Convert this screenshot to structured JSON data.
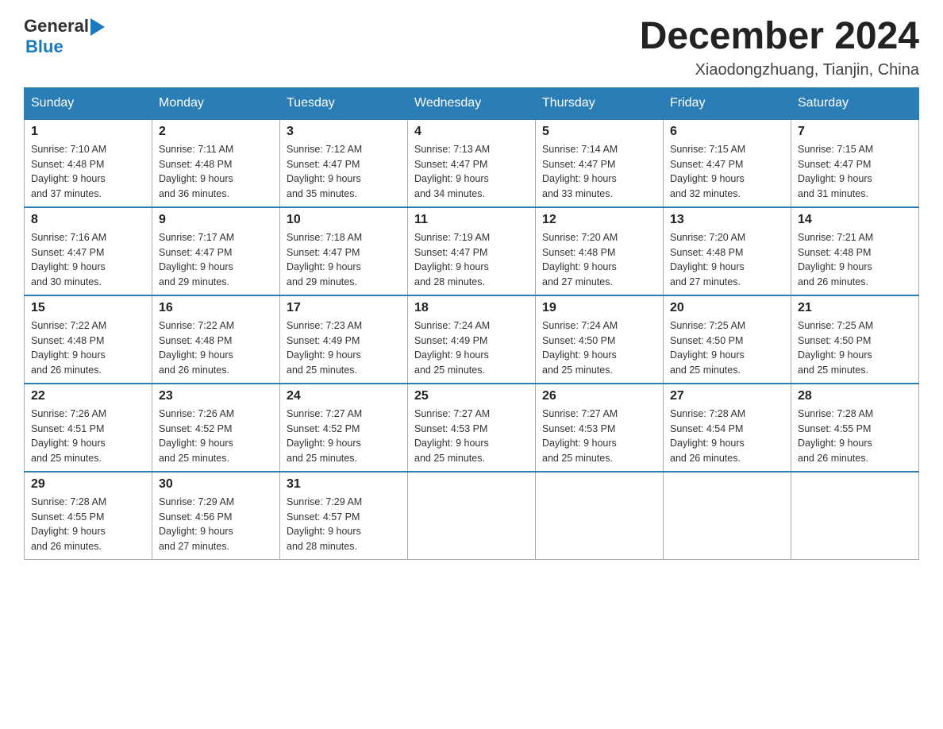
{
  "header": {
    "logo": {
      "general": "General",
      "blue": "Blue",
      "alt": "GeneralBlue Logo"
    },
    "title": "December 2024",
    "location": "Xiaodongzhuang, Tianjin, China"
  },
  "calendar": {
    "days_of_week": [
      "Sunday",
      "Monday",
      "Tuesday",
      "Wednesday",
      "Thursday",
      "Friday",
      "Saturday"
    ],
    "weeks": [
      [
        {
          "day": "1",
          "sunrise": "7:10 AM",
          "sunset": "4:48 PM",
          "daylight": "9 hours and 37 minutes."
        },
        {
          "day": "2",
          "sunrise": "7:11 AM",
          "sunset": "4:48 PM",
          "daylight": "9 hours and 36 minutes."
        },
        {
          "day": "3",
          "sunrise": "7:12 AM",
          "sunset": "4:47 PM",
          "daylight": "9 hours and 35 minutes."
        },
        {
          "day": "4",
          "sunrise": "7:13 AM",
          "sunset": "4:47 PM",
          "daylight": "9 hours and 34 minutes."
        },
        {
          "day": "5",
          "sunrise": "7:14 AM",
          "sunset": "4:47 PM",
          "daylight": "9 hours and 33 minutes."
        },
        {
          "day": "6",
          "sunrise": "7:15 AM",
          "sunset": "4:47 PM",
          "daylight": "9 hours and 32 minutes."
        },
        {
          "day": "7",
          "sunrise": "7:15 AM",
          "sunset": "4:47 PM",
          "daylight": "9 hours and 31 minutes."
        }
      ],
      [
        {
          "day": "8",
          "sunrise": "7:16 AM",
          "sunset": "4:47 PM",
          "daylight": "9 hours and 30 minutes."
        },
        {
          "day": "9",
          "sunrise": "7:17 AM",
          "sunset": "4:47 PM",
          "daylight": "9 hours and 29 minutes."
        },
        {
          "day": "10",
          "sunrise": "7:18 AM",
          "sunset": "4:47 PM",
          "daylight": "9 hours and 29 minutes."
        },
        {
          "day": "11",
          "sunrise": "7:19 AM",
          "sunset": "4:47 PM",
          "daylight": "9 hours and 28 minutes."
        },
        {
          "day": "12",
          "sunrise": "7:20 AM",
          "sunset": "4:48 PM",
          "daylight": "9 hours and 27 minutes."
        },
        {
          "day": "13",
          "sunrise": "7:20 AM",
          "sunset": "4:48 PM",
          "daylight": "9 hours and 27 minutes."
        },
        {
          "day": "14",
          "sunrise": "7:21 AM",
          "sunset": "4:48 PM",
          "daylight": "9 hours and 26 minutes."
        }
      ],
      [
        {
          "day": "15",
          "sunrise": "7:22 AM",
          "sunset": "4:48 PM",
          "daylight": "9 hours and 26 minutes."
        },
        {
          "day": "16",
          "sunrise": "7:22 AM",
          "sunset": "4:48 PM",
          "daylight": "9 hours and 26 minutes."
        },
        {
          "day": "17",
          "sunrise": "7:23 AM",
          "sunset": "4:49 PM",
          "daylight": "9 hours and 25 minutes."
        },
        {
          "day": "18",
          "sunrise": "7:24 AM",
          "sunset": "4:49 PM",
          "daylight": "9 hours and 25 minutes."
        },
        {
          "day": "19",
          "sunrise": "7:24 AM",
          "sunset": "4:50 PM",
          "daylight": "9 hours and 25 minutes."
        },
        {
          "day": "20",
          "sunrise": "7:25 AM",
          "sunset": "4:50 PM",
          "daylight": "9 hours and 25 minutes."
        },
        {
          "day": "21",
          "sunrise": "7:25 AM",
          "sunset": "4:50 PM",
          "daylight": "9 hours and 25 minutes."
        }
      ],
      [
        {
          "day": "22",
          "sunrise": "7:26 AM",
          "sunset": "4:51 PM",
          "daylight": "9 hours and 25 minutes."
        },
        {
          "day": "23",
          "sunrise": "7:26 AM",
          "sunset": "4:52 PM",
          "daylight": "9 hours and 25 minutes."
        },
        {
          "day": "24",
          "sunrise": "7:27 AM",
          "sunset": "4:52 PM",
          "daylight": "9 hours and 25 minutes."
        },
        {
          "day": "25",
          "sunrise": "7:27 AM",
          "sunset": "4:53 PM",
          "daylight": "9 hours and 25 minutes."
        },
        {
          "day": "26",
          "sunrise": "7:27 AM",
          "sunset": "4:53 PM",
          "daylight": "9 hours and 25 minutes."
        },
        {
          "day": "27",
          "sunrise": "7:28 AM",
          "sunset": "4:54 PM",
          "daylight": "9 hours and 26 minutes."
        },
        {
          "day": "28",
          "sunrise": "7:28 AM",
          "sunset": "4:55 PM",
          "daylight": "9 hours and 26 minutes."
        }
      ],
      [
        {
          "day": "29",
          "sunrise": "7:28 AM",
          "sunset": "4:55 PM",
          "daylight": "9 hours and 26 minutes."
        },
        {
          "day": "30",
          "sunrise": "7:29 AM",
          "sunset": "4:56 PM",
          "daylight": "9 hours and 27 minutes."
        },
        {
          "day": "31",
          "sunrise": "7:29 AM",
          "sunset": "4:57 PM",
          "daylight": "9 hours and 28 minutes."
        },
        null,
        null,
        null,
        null
      ]
    ],
    "labels": {
      "sunrise": "Sunrise: ",
      "sunset": "Sunset: ",
      "daylight": "Daylight: "
    }
  }
}
